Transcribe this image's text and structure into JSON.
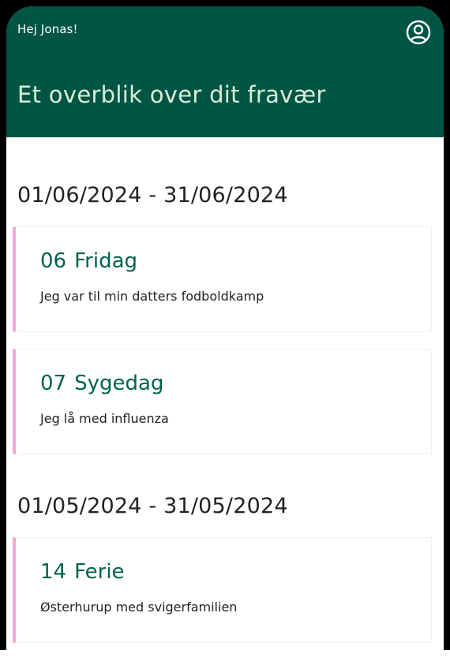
{
  "header": {
    "greeting": "Hej Jonas!",
    "title": "Et overblik over dit fravær",
    "profile_icon": "user-circle-icon",
    "background_color": "#005544",
    "title_color": "#d9eed8"
  },
  "periods": [
    {
      "range": "01/06/2024 - 31/06/2024",
      "entries": [
        {
          "day": "06",
          "type": "Fridag",
          "description": "Jeg var til min datters fodboldkamp"
        },
        {
          "day": "07",
          "type": "Sygedag",
          "description": "Jeg lå med influenza"
        }
      ]
    },
    {
      "range": "01/05/2024 - 31/05/2024",
      "entries": [
        {
          "day": "14",
          "type": "Ferie",
          "description": "Østerhurup med svigerfamilien"
        }
      ]
    }
  ],
  "colors": {
    "accent_bar": "#f2a7d4",
    "entry_title": "#00634d"
  }
}
